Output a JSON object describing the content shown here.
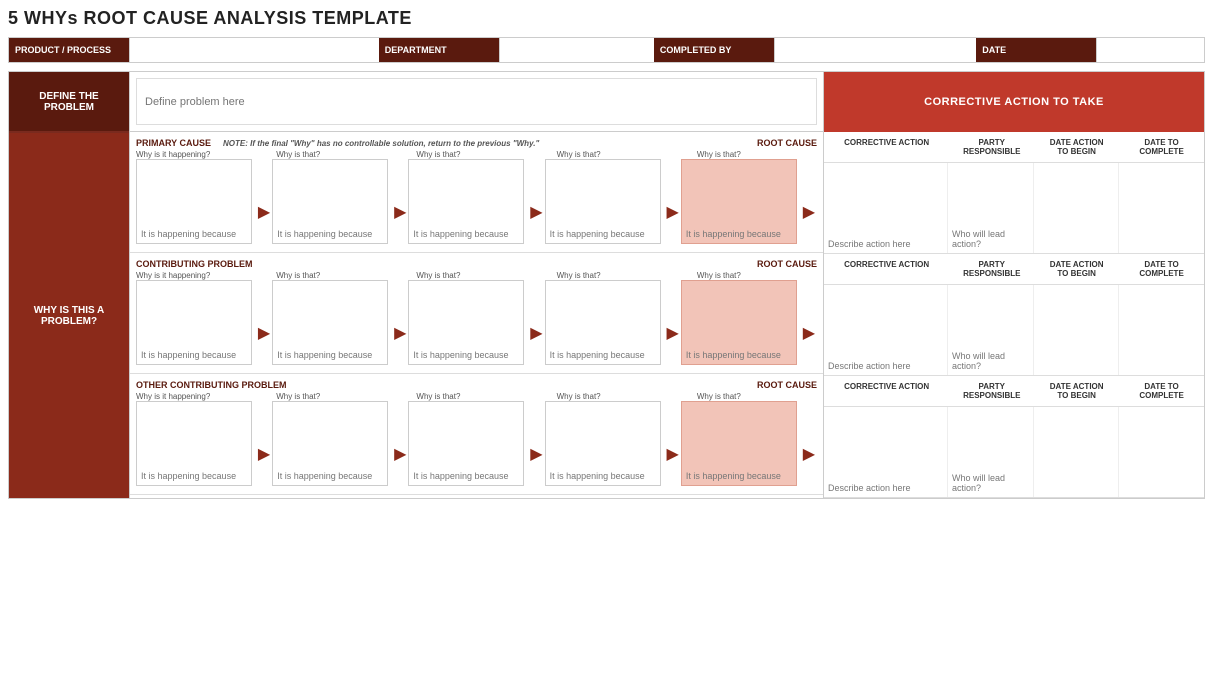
{
  "title": "5 WHYs ROOT CAUSE ANALYSIS TEMPLATE",
  "header": {
    "product_label": "PRODUCT / PROCESS",
    "product_value": "",
    "department_label": "DEPARTMENT",
    "department_value": "",
    "completed_by_label": "COMPLETED BY",
    "completed_by_value": "",
    "date_label": "DATE",
    "date_value": ""
  },
  "define_problem": {
    "label": "DEFINE THE\nPROBLEM",
    "placeholder": "Define problem here"
  },
  "corrective_header": "CORRECTIVE ACTION TO TAKE",
  "why_is_problem_label": "WHY IS THIS A\nPROBLEM?",
  "sections": [
    {
      "cause_title": "PRIMARY CAUSE",
      "note": "NOTE: If the final \"Why\" has no controllable solution, return to the previous \"Why.\"",
      "root_cause_label": "ROOT CAUSE",
      "whys": [
        {
          "sub_label": "Why is it happening?",
          "text": "It is happening because",
          "pink": false
        },
        {
          "sub_label": "Why is that?",
          "text": "It is happening because",
          "pink": false
        },
        {
          "sub_label": "Why is that?",
          "text": "It is happening because",
          "pink": false
        },
        {
          "sub_label": "Why is that?",
          "text": "It is happening because",
          "pink": false
        },
        {
          "sub_label": "Why is that?",
          "text": "It is happening because",
          "pink": true
        }
      ],
      "corrective_action_text": "Describe action here",
      "party_responsible_text": "Who will lead action?",
      "date_begin_text": "",
      "date_complete_text": ""
    },
    {
      "cause_title": "CONTRIBUTING PROBLEM",
      "note": "",
      "root_cause_label": "ROOT CAUSE",
      "whys": [
        {
          "sub_label": "Why is it happening?",
          "text": "It is happening because",
          "pink": false
        },
        {
          "sub_label": "Why is that?",
          "text": "It is happening because",
          "pink": false
        },
        {
          "sub_label": "Why is that?",
          "text": "It is happening because",
          "pink": false
        },
        {
          "sub_label": "Why is that?",
          "text": "It is happening because",
          "pink": false
        },
        {
          "sub_label": "Why is that?",
          "text": "It is happening because",
          "pink": true
        }
      ],
      "corrective_action_text": "Describe action here",
      "party_responsible_text": "Who will lead action?",
      "date_begin_text": "",
      "date_complete_text": ""
    },
    {
      "cause_title": "OTHER CONTRIBUTING PROBLEM",
      "note": "",
      "root_cause_label": "ROOT CAUSE",
      "whys": [
        {
          "sub_label": "Why is it happening?",
          "text": "It is happening because",
          "pink": false
        },
        {
          "sub_label": "Why is that?",
          "text": "It is happening because",
          "pink": false
        },
        {
          "sub_label": "Why is that?",
          "text": "It is happening because",
          "pink": false
        },
        {
          "sub_label": "Why is that?",
          "text": "It is happening because",
          "pink": false
        },
        {
          "sub_label": "Why is that?",
          "text": "It is happening because",
          "pink": true
        }
      ],
      "corrective_action_text": "Describe action here",
      "party_responsible_text": "Who will lead action?",
      "date_begin_text": "",
      "date_complete_text": ""
    }
  ],
  "col_headers": {
    "corrective_action": "CORRECTIVE ACTION",
    "party_responsible": "PARTY\nRESPONSIBLE",
    "date_action_begin": "DATE ACTION\nTO BEGIN",
    "date_to_complete": "DATE TO\nCOMPLETE"
  }
}
